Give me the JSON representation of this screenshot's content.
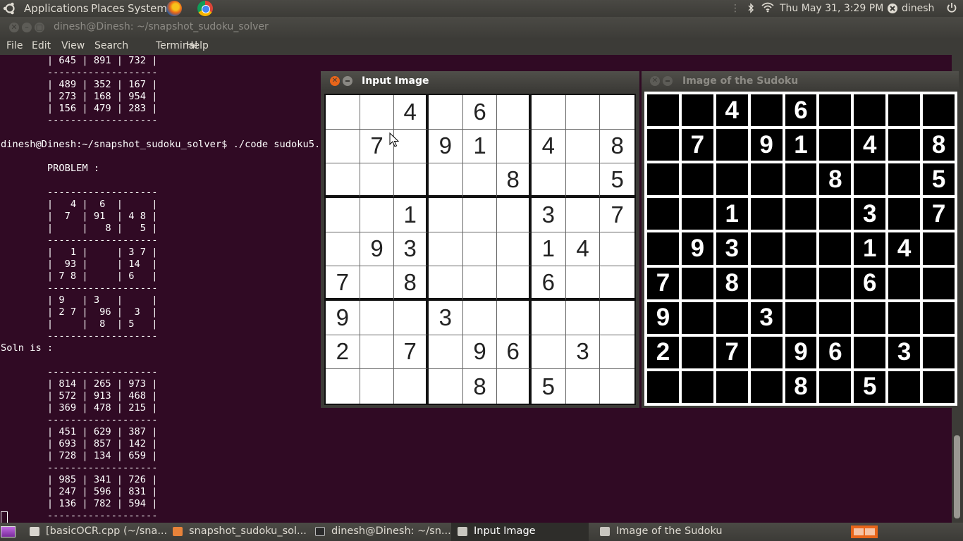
{
  "top_panel": {
    "menus": [
      "Applications",
      "Places",
      "System"
    ],
    "datetime": "Thu May 31,  3:29 PM",
    "user": "dinesh"
  },
  "terminal": {
    "title": "dinesh@Dinesh: ~/snapshot_sudoku_solver",
    "menu": [
      "File",
      "Edit",
      "View",
      "Search",
      "Terminal",
      "Help"
    ],
    "output": "        | 645 | 891 | 732 |\n        -------------------\n        | 489 | 352 | 167 |\n        | 273 | 168 | 954 |\n        | 156 | 479 | 283 |\n        -------------------\n\ndinesh@Dinesh:~/snapshot_sudoku_solver$ ./code sudoku5.jpg\n\n        PROBLEM :\n\n        -------------------\n        |   4 |  6  |     |\n        |  7  | 91  | 4 8 |\n        |     |   8 |   5 |\n        -------------------\n        |   1 |     | 3 7 |\n        |  93 |     | 14  |\n        | 7 8 |     | 6   |\n        -------------------\n        | 9   | 3   |     |\n        | 2 7 |  96 |  3  |\n        |     |  8  | 5   |\n        -------------------\nSoln is :\n\n        -------------------\n        | 814 | 265 | 973 |\n        | 572 | 913 | 468 |\n        | 369 | 478 | 215 |\n        -------------------\n        | 451 | 629 | 387 |\n        | 693 | 857 | 142 |\n        | 728 | 134 | 659 |\n        -------------------\n        | 985 | 341 | 726 |\n        | 247 | 596 | 831 |\n        | 136 | 782 | 594 |\n        -------------------"
  },
  "input_window": {
    "title": "Input Image",
    "grid": [
      [
        "",
        "",
        "4",
        "",
        "6",
        "",
        "",
        "",
        ""
      ],
      [
        "",
        "7",
        "",
        "9",
        "1",
        "",
        "4",
        "",
        "8"
      ],
      [
        "",
        "",
        "",
        "",
        "",
        "8",
        "",
        "",
        "5"
      ],
      [
        "",
        "",
        "1",
        "",
        "",
        "",
        "3",
        "",
        "7"
      ],
      [
        "",
        "9",
        "3",
        "",
        "",
        "",
        "1",
        "4",
        ""
      ],
      [
        "7",
        "",
        "8",
        "",
        "",
        "",
        "6",
        "",
        ""
      ],
      [
        "9",
        "",
        "",
        "3",
        "",
        "",
        "",
        "",
        ""
      ],
      [
        "2",
        "",
        "7",
        "",
        "9",
        "6",
        "",
        "3",
        ""
      ],
      [
        "",
        "",
        "",
        "",
        "8",
        "",
        "5",
        "",
        ""
      ]
    ]
  },
  "binary_window": {
    "title": "Image of the Sudoku"
  },
  "taskbar": {
    "items": [
      {
        "label": "[basicOCR.cpp (~/sna...",
        "icon": "text-editor-icon"
      },
      {
        "label": "snapshot_sudoku_sol...",
        "icon": "folder-icon"
      },
      {
        "label": "dinesh@Dinesh: ~/sn...",
        "icon": "terminal-icon"
      },
      {
        "label": "Input Image",
        "icon": "window-icon"
      },
      {
        "label": "Image of the Sudoku",
        "icon": "window-icon"
      }
    ]
  },
  "colors": {
    "terminal_bg": "#300a24",
    "panel_bg": "#3c3b37",
    "close_active": "#e8651a"
  }
}
